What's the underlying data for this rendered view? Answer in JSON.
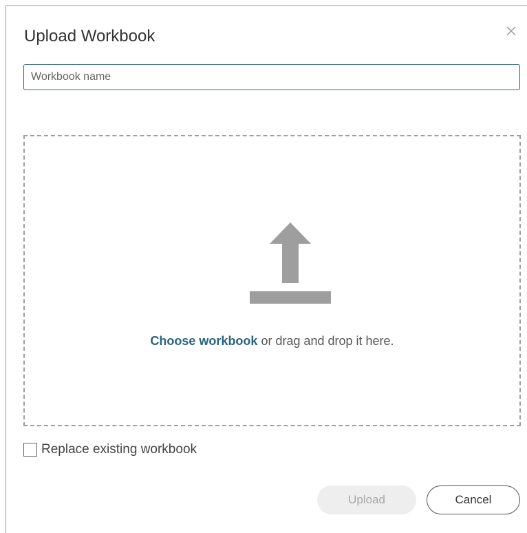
{
  "dialog": {
    "title": "Upload Workbook",
    "close_icon": "close-icon"
  },
  "name_field": {
    "placeholder": "Workbook name",
    "value": ""
  },
  "dropzone": {
    "icon": "upload-arrow-icon",
    "choose_link": "Choose workbook",
    "drop_text": " or drag and drop it here."
  },
  "replace_option": {
    "label": "Replace existing workbook",
    "checked": false
  },
  "buttons": {
    "upload": "Upload",
    "upload_enabled": false,
    "cancel": "Cancel"
  },
  "colors": {
    "accent": "#2a6480",
    "icon_gray": "#9e9e9e",
    "disabled_bg": "#eeeeee",
    "disabled_text": "#a8a8a8"
  }
}
